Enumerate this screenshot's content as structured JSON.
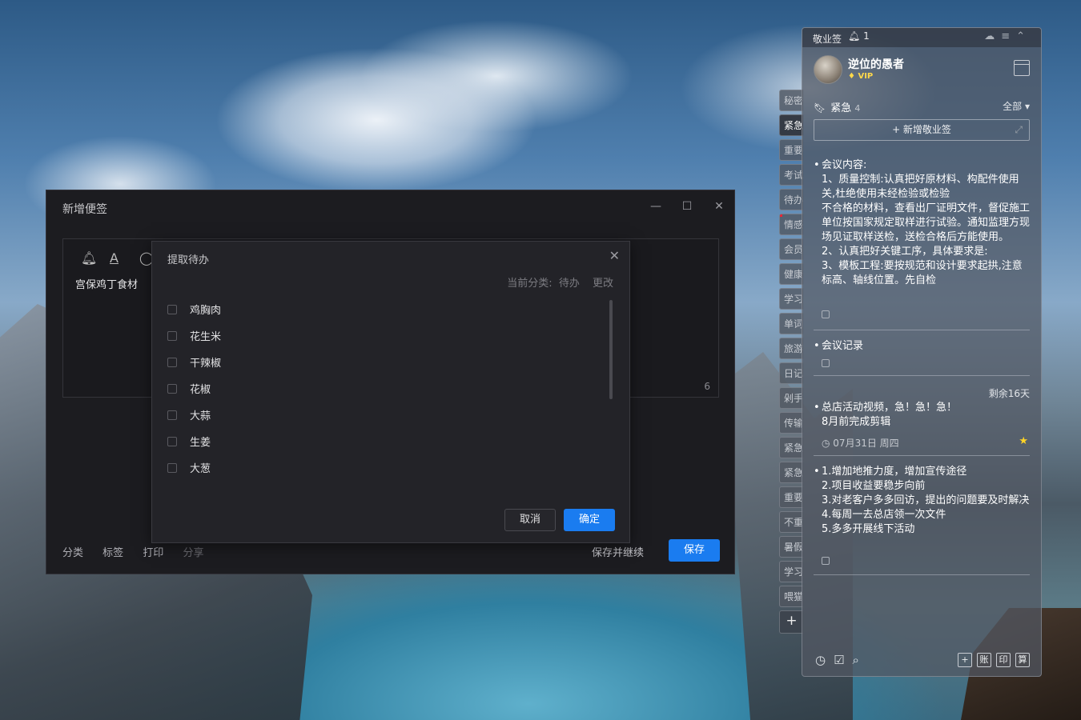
{
  "editor": {
    "title": "新增便签",
    "content": "宫保鸡丁食材",
    "char_count": "6",
    "footer": {
      "category": "分类",
      "tag": "标签",
      "print": "打印",
      "share": "分享"
    },
    "save_continue": "保存并继续",
    "save": "保存"
  },
  "todo_modal": {
    "title": "提取待办",
    "category_label": "当前分类:",
    "category_value": "待办",
    "change": "更改",
    "items": [
      "鸡胸肉",
      "花生米",
      "干辣椒",
      "花椒",
      "大蒜",
      "生姜",
      "大葱"
    ],
    "cancel": "取消",
    "confirm": "确定"
  },
  "side_tabs": [
    "秘密",
    "紧急",
    "重要",
    "考试",
    "待办",
    "情感",
    "会员",
    "健康",
    "学习",
    "单词",
    "旅游",
    "日记",
    "剁手",
    "传输",
    "紧急",
    "紧急",
    "重要",
    "不重",
    "暑假",
    "学习",
    "喂猫"
  ],
  "panel": {
    "app_name": "敬业签",
    "bell_count": "1",
    "user_name": "逆位的愚者",
    "vip": "VIP",
    "section_title": "紧急",
    "section_count": "4",
    "filter": "全部",
    "add_note": "+ 新增敬业签",
    "notes": [
      {
        "text": "会议内容:\n1、质量控制:认真把好原材料、构配件使用关,杜绝使用未经检验或检验\n不合格的材料，查看出厂证明文件，督促施工单位按国家规定取样进行试验。通知监理方现场见证取样送检，送检合格后方能使用。\n2、认真把好关键工序，具体要求是:\n3、模板工程:要按规范和设计要求起拱,注意标高、轴线位置。先自检"
      },
      {
        "text": "会议记录"
      },
      {
        "text": "总店活动视频，急！急！急！\n8月前完成剪辑",
        "remaining": "剩余16天",
        "date": "07月31日 周四"
      },
      {
        "text": "1.增加地推力度，增加宣传途径\n2.项目收益要稳步向前\n3.对老客户多多回访，提出的问题要及时解决\n4.每周一去总店领一次文件\n5.多多开展线下活动"
      }
    ],
    "footer_boxes": [
      "+",
      "账",
      "印",
      "算"
    ]
  }
}
